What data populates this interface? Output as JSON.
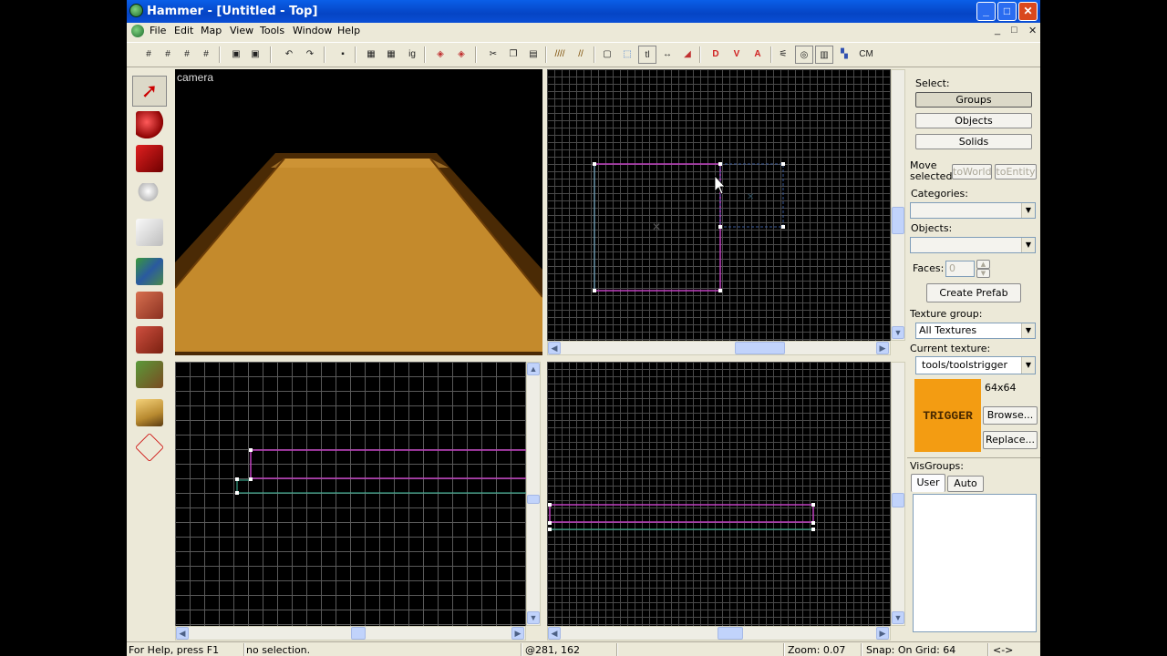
{
  "window": {
    "title": "Hammer - [Untitled - Top]",
    "caption_buttons": {
      "minimize": "_",
      "maximize": "□",
      "close": "✕"
    }
  },
  "menu": {
    "items": [
      "File",
      "Edit",
      "Map",
      "View",
      "Tools",
      "Window",
      "Help"
    ],
    "mdi_controls": [
      "_",
      "□",
      "✕"
    ]
  },
  "toolbar": {
    "labels": [
      "ig",
      "tl",
      "CM"
    ]
  },
  "left_tools": [
    {
      "name": "selection-tool",
      "icon": "pointer-icon"
    },
    {
      "name": "magnify-tool",
      "icon": "magnifier-icon"
    },
    {
      "name": "camera-tool",
      "icon": "camera-icon"
    },
    {
      "name": "entity-tool",
      "icon": "entity-icon"
    },
    {
      "name": "block-tool",
      "icon": "block-icon"
    },
    {
      "name": "texture-application-tool",
      "icon": "texture-icon"
    },
    {
      "name": "apply-current-texture-tool",
      "icon": "apply-texture-icon"
    },
    {
      "name": "decal-tool",
      "icon": "decal-icon"
    },
    {
      "name": "overlay-tool",
      "icon": "overlay-icon"
    },
    {
      "name": "clipping-tool",
      "icon": "clip-icon"
    },
    {
      "name": "vertex-tool",
      "icon": "vertex-icon"
    }
  ],
  "viewports": {
    "camera_label": "camera"
  },
  "right_panel": {
    "select_label": "Select:",
    "select_buttons": [
      "Groups",
      "Objects",
      "Solids"
    ],
    "move_selected_label": "Move selected:",
    "to_world": "toWorld",
    "to_entity": "toEntity",
    "categories_label": "Categories:",
    "objects_label": "Objects:",
    "faces_label": "Faces:",
    "faces_value": "0",
    "create_prefab": "Create Prefab",
    "texture_group_label": "Texture group:",
    "texture_group_value": "All Textures",
    "current_texture_label": "Current texture:",
    "current_texture_value": "tools/toolstrigger",
    "texture_size": "64x64",
    "texture_preview_text": "TRIGGER",
    "browse": "Browse...",
    "replace": "Replace...",
    "visgroups_label": "VisGroups:",
    "vis_tabs": [
      "User",
      "Auto"
    ]
  },
  "status": {
    "help": "For Help, press F1",
    "selection": "no selection.",
    "coords": "@281, 162",
    "zoom": "Zoom: 0.07",
    "snap": "Snap: On Grid: 64",
    "extra": "<->"
  },
  "colors": {
    "titlebar": "#0a5fe8",
    "selection_outline": "#c040c0",
    "trigger_texture": "#f39c12"
  }
}
